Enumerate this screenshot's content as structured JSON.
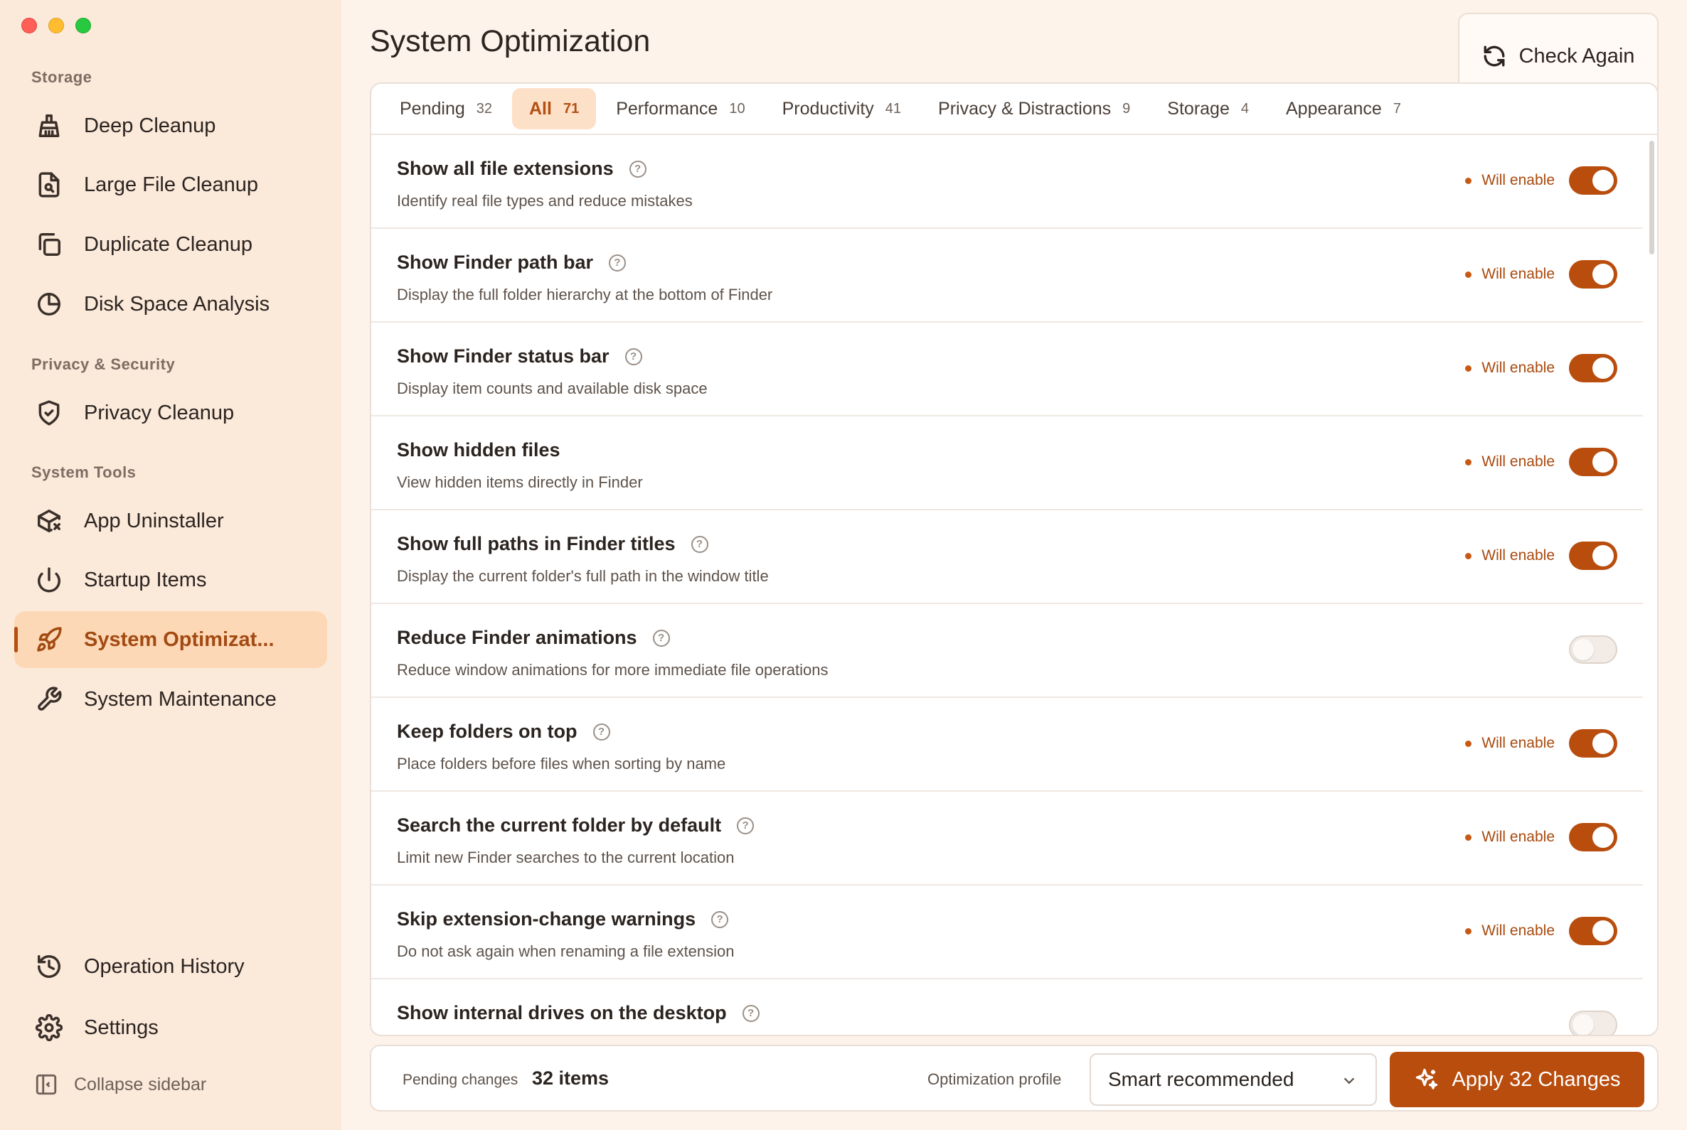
{
  "sidebar": {
    "sections": {
      "storage": "Storage",
      "privacy": "Privacy & Security",
      "system_tools": "System Tools"
    },
    "items": [
      {
        "label": "Deep Cleanup",
        "icon": "broom-icon"
      },
      {
        "label": "Large File Cleanup",
        "icon": "file-search-icon"
      },
      {
        "label": "Duplicate Cleanup",
        "icon": "copy-icon"
      },
      {
        "label": "Disk Space Analysis",
        "icon": "pie-chart-icon"
      },
      {
        "label": "Privacy Cleanup",
        "icon": "shield-check-icon"
      },
      {
        "label": "App Uninstaller",
        "icon": "package-x-icon"
      },
      {
        "label": "Startup Items",
        "icon": "power-icon"
      },
      {
        "label": "System Optimizat...",
        "icon": "rocket-icon",
        "active": true
      },
      {
        "label": "System Maintenance",
        "icon": "wrench-icon"
      }
    ],
    "bottom_items": [
      {
        "label": "Operation History",
        "icon": "history-icon"
      },
      {
        "label": "Settings",
        "icon": "gear-icon"
      }
    ],
    "collapse_label": "Collapse sidebar"
  },
  "header": {
    "title": "System Optimization",
    "check_again_label": "Check Again"
  },
  "tabs": [
    {
      "label": "Pending",
      "count": "32"
    },
    {
      "label": "All",
      "count": "71",
      "active": true
    },
    {
      "label": "Performance",
      "count": "10"
    },
    {
      "label": "Productivity",
      "count": "41"
    },
    {
      "label": "Privacy & Distractions",
      "count": "9"
    },
    {
      "label": "Storage",
      "count": "4"
    },
    {
      "label": "Appearance",
      "count": "7"
    }
  ],
  "rows": [
    {
      "title": "Show all file extensions",
      "desc": "Identify real file types and reduce mistakes",
      "help": true,
      "status": "Will enable",
      "enabled": true
    },
    {
      "title": "Show Finder path bar",
      "desc": "Display the full folder hierarchy at the bottom of Finder",
      "help": true,
      "status": "Will enable",
      "enabled": true
    },
    {
      "title": "Show Finder status bar",
      "desc": "Display item counts and available disk space",
      "help": true,
      "status": "Will enable",
      "enabled": true
    },
    {
      "title": "Show hidden files",
      "desc": "View hidden items directly in Finder",
      "help": false,
      "status": "Will enable",
      "enabled": true
    },
    {
      "title": "Show full paths in Finder titles",
      "desc": "Display the current folder's full path in the window title",
      "help": true,
      "status": "Will enable",
      "enabled": true
    },
    {
      "title": "Reduce Finder animations",
      "desc": "Reduce window animations for more immediate file operations",
      "help": true,
      "status": "",
      "enabled": false
    },
    {
      "title": "Keep folders on top",
      "desc": "Place folders before files when sorting by name",
      "help": true,
      "status": "Will enable",
      "enabled": true
    },
    {
      "title": "Search the current folder by default",
      "desc": "Limit new Finder searches to the current location",
      "help": true,
      "status": "Will enable",
      "enabled": true
    },
    {
      "title": "Skip extension-change warnings",
      "desc": "Do not ask again when renaming a file extension",
      "help": true,
      "status": "Will enable",
      "enabled": true
    },
    {
      "title": "Show internal drives on the desktop",
      "desc": "",
      "help": true,
      "status": "",
      "enabled": false
    }
  ],
  "help_glyph": "?",
  "footer": {
    "pending_label": "Pending changes",
    "pending_value": "32 items",
    "profile_label": "Optimization profile",
    "profile_value": "Smart recommended",
    "apply_label": "Apply 32 Changes"
  },
  "colors": {
    "accent": "#b84d0e",
    "sidebar_bg": "#fbe9da",
    "active_bg": "#fdd8b6"
  }
}
